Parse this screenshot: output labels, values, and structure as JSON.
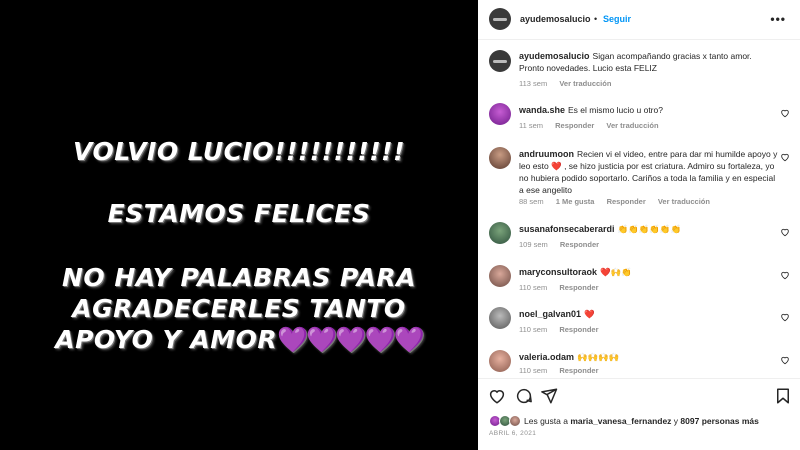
{
  "media": {
    "line1": "VOLVIO LUCIO!!!!!!!!!!!",
    "line2": "ESTAMOS FELICES",
    "line3a": "NO HAY PALABRAS PARA",
    "line3b": "AGRADECERLES TANTO",
    "line3c": "APOYO Y AMOR",
    "hearts": "💜💜💜💜💜"
  },
  "header": {
    "username": "ayudemosalucio",
    "dot": "•",
    "follow_label": "Seguir",
    "more_label": "•••"
  },
  "caption": {
    "username": "ayudemosalucio",
    "text": "Sigan acompañando gracias x tanto amor. Pronto novedades. Lucio esta FELIZ",
    "time": "113 sem",
    "translate": "Ver traducción"
  },
  "comments": [
    {
      "username": "wanda.she",
      "text": "Es el mismo lucio u otro?",
      "time": "11 sem",
      "reply": "Responder",
      "translate": "Ver traducción"
    },
    {
      "username": "andruumoon",
      "text": "Recien vi el video, entre para dar mi humilde apoyo y leo esto ❤️ , se hizo justicia por est criatura. Admiro su fortaleza, yo no hubiera podido soportarlo. Cariños a toda la familia y en especial a ese angelito",
      "time": "88 sem",
      "likes": "1 Me gusta",
      "reply": "Responder",
      "translate": "Ver traducción"
    },
    {
      "username": "susanafonsecaberardi",
      "text": "👏👏👏👏👏👏",
      "time": "109 sem",
      "reply": "Responder"
    },
    {
      "username": "maryconsultoraok",
      "text": "❤️🙌👏",
      "time": "110 sem",
      "reply": "Responder"
    },
    {
      "username": "noel_galvan01",
      "text": "❤️",
      "time": "110 sem",
      "reply": "Responder"
    },
    {
      "username": "valeria.odam",
      "text": "🙌🙌🙌🙌",
      "time": "110 sem",
      "reply": "Responder"
    }
  ],
  "footer": {
    "likes_prefix": "Les gusta a ",
    "likes_user": "maria_vanesa_fernandez",
    "likes_mid": " y ",
    "likes_count": "8097 personas más",
    "date": "ABRIL 6, 2021"
  },
  "icons": {
    "like": "heart-icon",
    "comment": "comment-icon",
    "share": "share-icon",
    "save": "bookmark-icon",
    "more": "more-options-icon"
  }
}
